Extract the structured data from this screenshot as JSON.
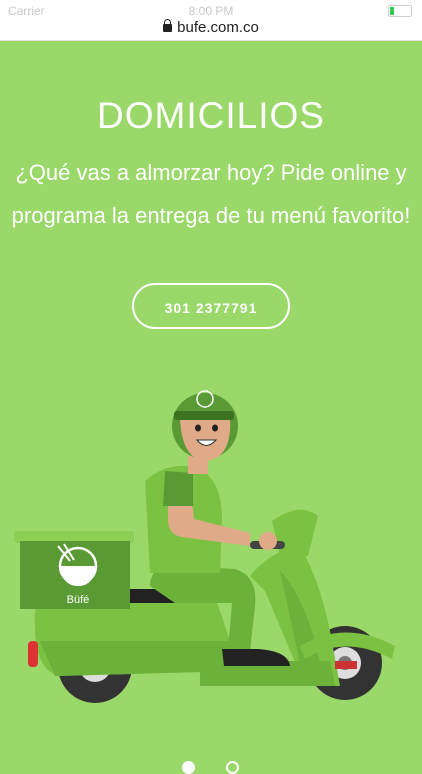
{
  "status": {
    "carrier": "Carrier",
    "time": "8:00 PM"
  },
  "browser": {
    "url": "bufe.com.co"
  },
  "hero": {
    "title": "DOMICILIOS",
    "subtitle": "¿Qué vas a almorzar hoy? Pide online y programa la entrega de tu menú favorito!",
    "phone_button": "301 2377791",
    "box_brand": "Büfé"
  },
  "carousel": {
    "current": 1,
    "total": 2
  },
  "colors": {
    "background": "#9ad86a",
    "scooter": "#7cc242",
    "dark_green": "#5a9a34"
  }
}
